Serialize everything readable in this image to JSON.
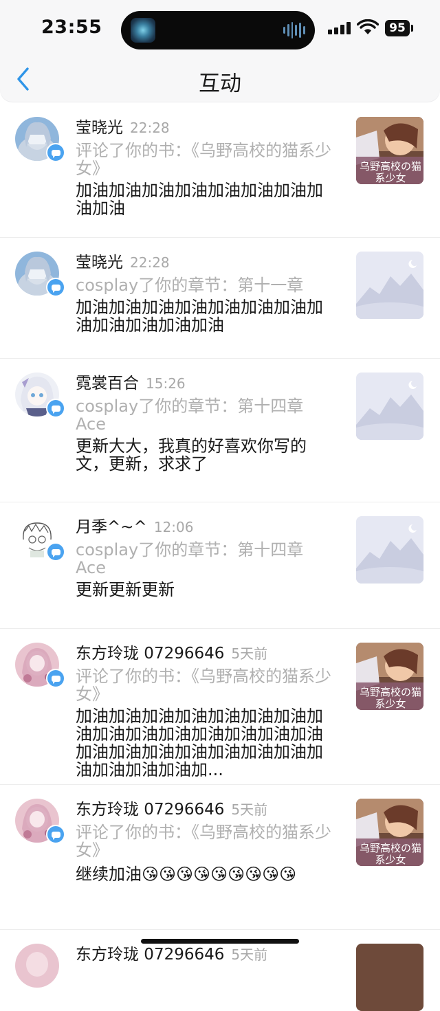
{
  "status_bar": {
    "time": "23:55",
    "battery": "95"
  },
  "nav": {
    "title": "互动"
  },
  "items": [
    {
      "user": "莹晓光",
      "time": "22:28",
      "action": "评论了你的书：《乌野高校的猫系少女》",
      "comment": "加油加油加油加油加油加油加油加油加油",
      "thumb_text": "乌野高校の猫系少女"
    },
    {
      "user": "莹晓光",
      "time": "22:28",
      "action": "cosplay了你的章节：第十一章",
      "comment": "加油加油加油加油加油加油加油加油加油加油加油加油",
      "thumb_text": ""
    },
    {
      "user": "霓裳百合",
      "time": "15:26",
      "action": "cosplay了你的章节：第十四章 Ace",
      "comment": "更新大大，我真的好喜欢你写的文，更新，求求了",
      "thumb_text": ""
    },
    {
      "user": "月季^~^",
      "time": "12:06",
      "action": "cosplay了你的章节：第十四章 Ace",
      "comment": "更新更新更新",
      "thumb_text": ""
    },
    {
      "user": "东方玲珑 07296646",
      "time": "5天前",
      "action": "评论了你的书：《乌野高校的猫系少女》",
      "comment": "加油加油加油加油加油加油加油加油加油加油加油加油加油加油加油加油加油加油加油加油加油加油加油加油加油加油加...",
      "thumb_text": "乌野高校の猫系少女"
    },
    {
      "user": "东方玲珑 07296646",
      "time": "5天前",
      "action": "评论了你的书：《乌野高校的猫系少女》",
      "comment": "继续加油😘😘😘😘😘😘😘😘😘",
      "thumb_text": "乌野高校の猫系少女"
    },
    {
      "user": "东方玲珑 07296646",
      "time": "5天前",
      "action": "",
      "comment": "",
      "thumb_text": ""
    }
  ]
}
